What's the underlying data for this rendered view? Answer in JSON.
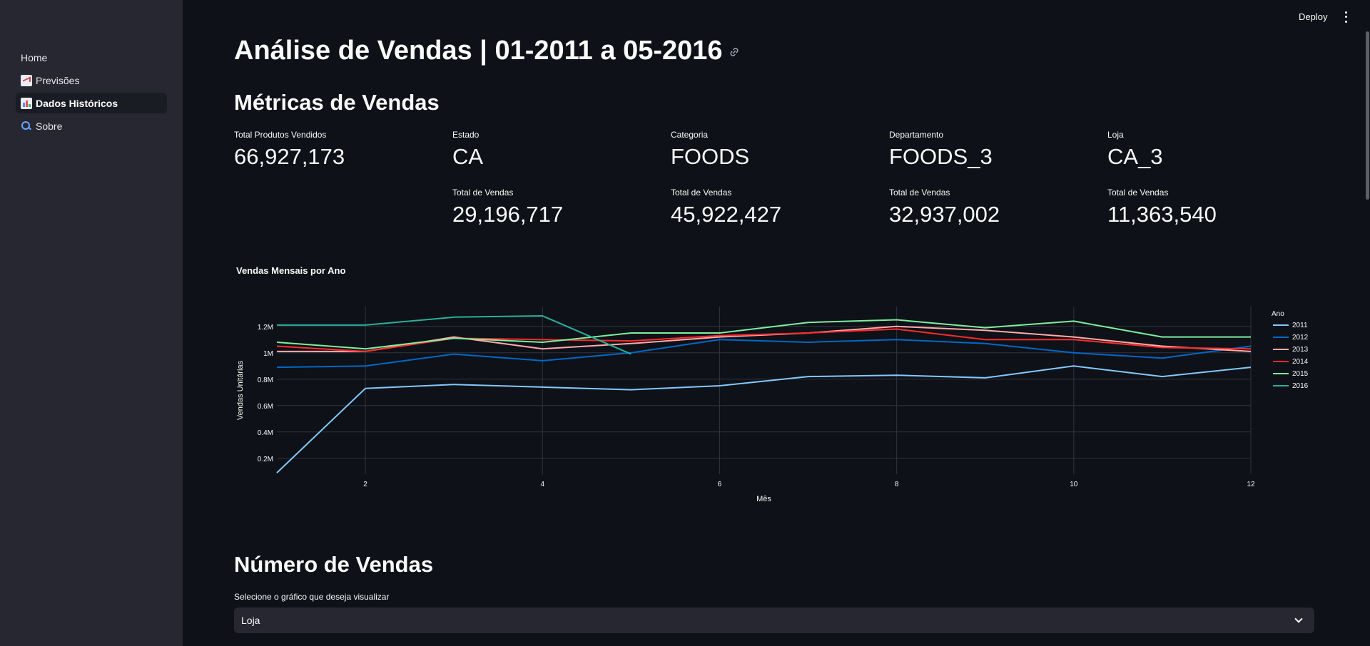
{
  "sidebar": {
    "items": [
      {
        "label": "Home",
        "icon": ""
      },
      {
        "label": "Previsões",
        "icon": "chart-increasing-icon"
      },
      {
        "label": "Dados Históricos",
        "icon": "bar-chart-icon",
        "active": true
      },
      {
        "label": "Sobre",
        "icon": "magnifier-icon"
      }
    ]
  },
  "toolbar": {
    "deploy_label": "Deploy"
  },
  "page": {
    "title": "Análise de Vendas | 01-2011 a 05-2016"
  },
  "metrics_section": {
    "title": "Métricas de Vendas",
    "metrics": [
      {
        "label": "Total Produtos Vendidos",
        "value": "66,927,173"
      },
      {
        "label": "Estado",
        "value": "CA"
      },
      {
        "label": "Categoria",
        "value": "FOODS"
      },
      {
        "label": "Departamento",
        "value": "FOODS_3"
      },
      {
        "label": "Loja",
        "value": "CA_3"
      }
    ],
    "totals": [
      {
        "label": "Total de Vendas",
        "value": "29,196,717"
      },
      {
        "label": "Total de Vendas",
        "value": "45,922,427"
      },
      {
        "label": "Total de Vendas",
        "value": "32,937,002"
      },
      {
        "label": "Total de Vendas",
        "value": "11,363,540"
      }
    ]
  },
  "chart_data": {
    "type": "line",
    "title": "Vendas Mensais por Ano",
    "xlabel": "Mês",
    "ylabel": "Vendas Unitárias",
    "legend_title": "Ano",
    "legend_position": "right",
    "grid": true,
    "xlim": [
      1,
      12
    ],
    "ylim": [
      0.08,
      1.35
    ],
    "xticks": [
      2,
      4,
      6,
      8,
      10,
      12
    ],
    "yticks": [
      0.2,
      0.4,
      0.6,
      0.8,
      1.0,
      1.2
    ],
    "ytick_labels": [
      "0.2M",
      "0.4M",
      "0.6M",
      "0.8M",
      "1M",
      "1.2M"
    ],
    "series": [
      {
        "name": "2011",
        "color": "#83c9ff",
        "x": [
          1,
          2,
          3,
          4,
          5,
          6,
          7,
          8,
          9,
          10,
          11,
          12
        ],
        "values": [
          0.09,
          0.73,
          0.76,
          0.74,
          0.72,
          0.75,
          0.82,
          0.83,
          0.81,
          0.9,
          0.82,
          0.89
        ]
      },
      {
        "name": "2012",
        "color": "#0068c9",
        "x": [
          1,
          2,
          3,
          4,
          5,
          6,
          7,
          8,
          9,
          10,
          11,
          12
        ],
        "values": [
          0.89,
          0.9,
          0.99,
          0.94,
          1.0,
          1.1,
          1.08,
          1.1,
          1.07,
          1.0,
          0.96,
          1.05
        ]
      },
      {
        "name": "2013",
        "color": "#ffabab",
        "x": [
          1,
          2,
          3,
          4,
          5,
          6,
          7,
          8,
          9,
          10,
          11,
          12
        ],
        "values": [
          1.01,
          1.01,
          1.12,
          1.03,
          1.07,
          1.12,
          1.15,
          1.2,
          1.17,
          1.12,
          1.05,
          1.01
        ]
      },
      {
        "name": "2014",
        "color": "#ff2b2b",
        "x": [
          1,
          2,
          3,
          4,
          5,
          6,
          7,
          8,
          9,
          10,
          11,
          12
        ],
        "values": [
          1.05,
          1.01,
          1.11,
          1.1,
          1.09,
          1.13,
          1.15,
          1.18,
          1.1,
          1.1,
          1.04,
          1.03
        ]
      },
      {
        "name": "2015",
        "color": "#7defa1",
        "x": [
          1,
          2,
          3,
          4,
          5,
          6,
          7,
          8,
          9,
          10,
          11,
          12
        ],
        "values": [
          1.08,
          1.03,
          1.11,
          1.08,
          1.15,
          1.15,
          1.23,
          1.25,
          1.19,
          1.24,
          1.12,
          1.12
        ]
      },
      {
        "name": "2016",
        "color": "#29b09d",
        "x": [
          1,
          2,
          3,
          4,
          5
        ],
        "values": [
          1.21,
          1.21,
          1.27,
          1.28,
          0.99
        ]
      }
    ]
  },
  "sales_section": {
    "title": "Número de Vendas",
    "select_label": "Selecione o gráfico que deseja visualizar",
    "select_value": "Loja"
  }
}
